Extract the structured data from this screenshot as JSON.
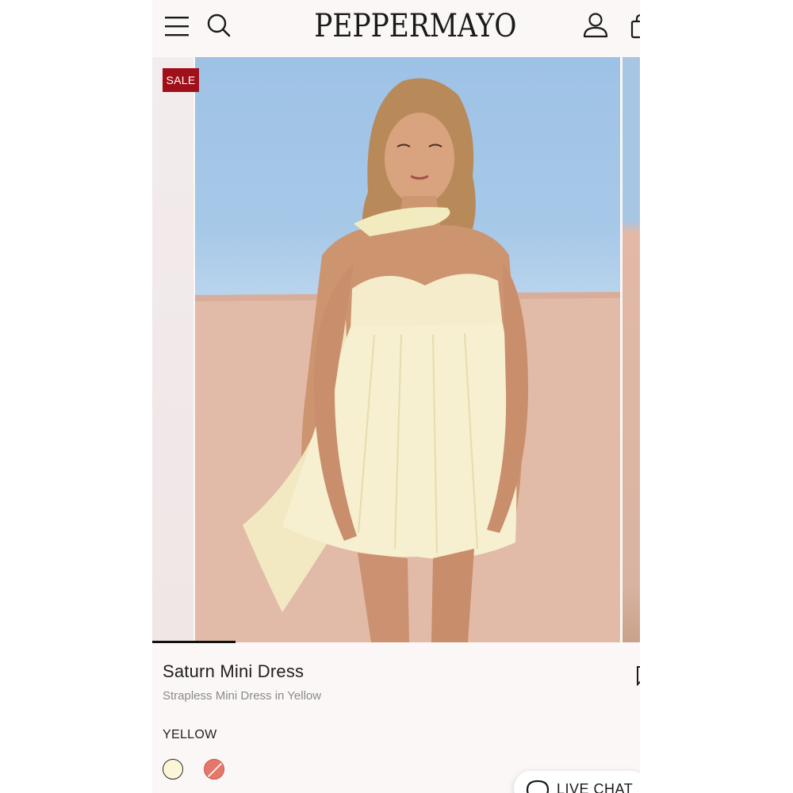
{
  "header": {
    "brand": "PEPPERMAYO",
    "menu_icon": "hamburger-menu-icon",
    "search_icon": "search-icon",
    "account_icon": "account-icon",
    "bag_icon": "shopping-bag-icon"
  },
  "gallery": {
    "badge": "SALE",
    "current_image": 1,
    "progress_fraction": 0.17
  },
  "product": {
    "title": "Saturn Mini Dress",
    "subtitle": "Strapless Mini Dress in Yellow",
    "selected_color": "YELLOW",
    "swatches": [
      {
        "name": "Yellow",
        "color": "#fbf6d8",
        "selected": true
      },
      {
        "name": "Coral",
        "color": "#e5786a",
        "selected": false,
        "unavailable": true
      }
    ]
  },
  "live_chat": {
    "label": "LIVE CHAT",
    "icon": "chat-bubble-icon"
  },
  "colors": {
    "sale": "#a0101a",
    "background": "#fbf7f6",
    "text": "#1f1f1f",
    "muted": "#8a8a8a"
  }
}
